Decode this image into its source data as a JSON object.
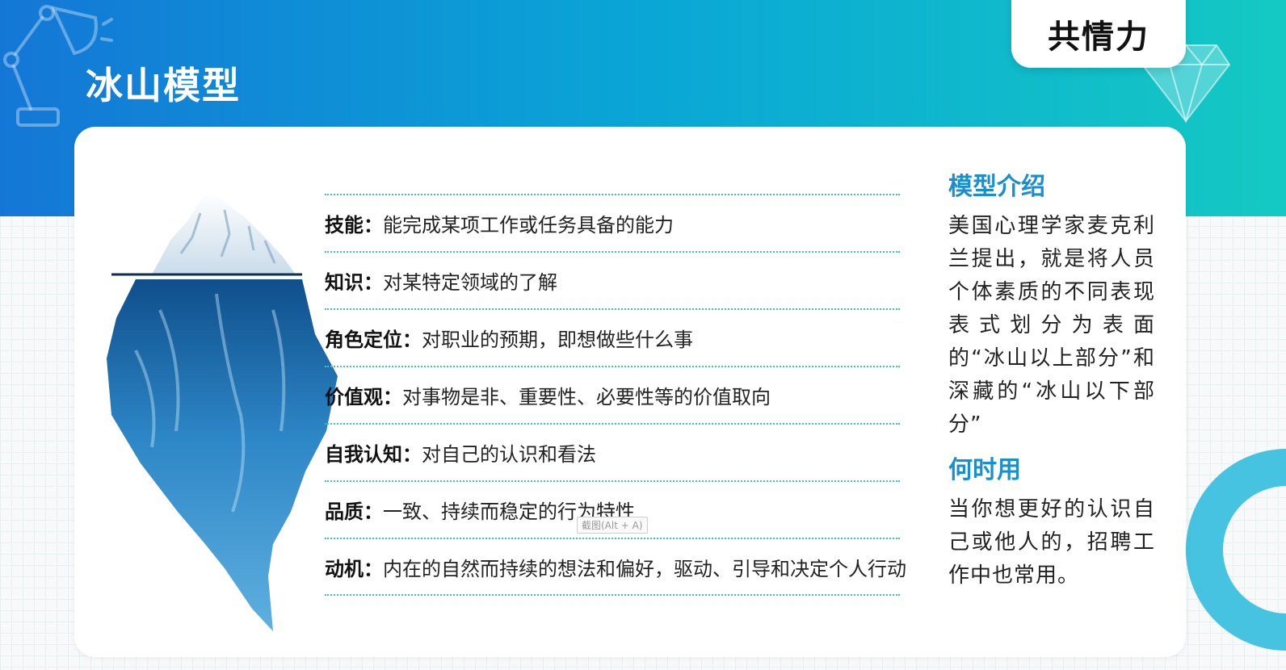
{
  "header": {
    "title": "冰山模型",
    "tag": "共情力",
    "colors": {
      "gradient_start": "#1477d6",
      "gradient_end": "#14c9c3"
    },
    "icons": [
      "desk-lamp-icon",
      "diamond-icon"
    ]
  },
  "traits": [
    {
      "name": "技能：",
      "desc": "能完成某项工作或任务具备的能力"
    },
    {
      "name": "知识：",
      "desc": "对某特定领域的了解"
    },
    {
      "name": "角色定位：",
      "desc": "对职业的预期，即想做些什么事"
    },
    {
      "name": "价值观：",
      "desc": "对事物是非、重要性、必要性等的价值取向"
    },
    {
      "name": "自我认知：",
      "desc": "对自己的认识和看法"
    },
    {
      "name": "品质：",
      "desc": "一致、持续而稳定的行为特性"
    },
    {
      "name": "动机：",
      "desc": "内在的自然而持续的想法和偏好，驱动、引导和决定个人行动"
    }
  ],
  "tooltip": "截图(Alt + A)",
  "sidebar": {
    "intro_heading": "模型介绍",
    "intro_text": "美国心理学家麦克利兰提出，就是将人员个体素质的不同表现表式划分为表面的“冰山以上部分”和深藏的“冰山以下部分”",
    "when_heading": "何时用",
    "when_text": "当你想更好的认识自己或他人的，招聘工作中也常用。"
  }
}
